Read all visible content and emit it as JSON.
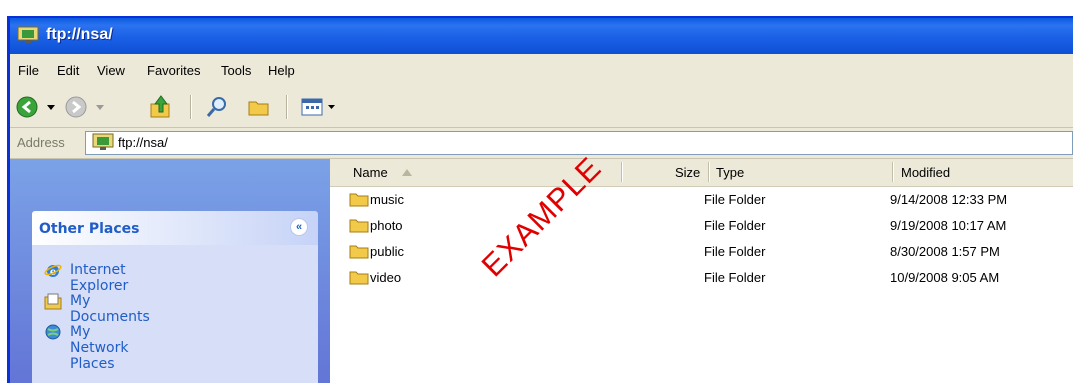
{
  "window": {
    "title": "ftp://nsa/",
    "title_icon": "network-folder-icon"
  },
  "menu": [
    "File",
    "Edit",
    "View",
    "Favorites",
    "Tools",
    "Help"
  ],
  "toolbar": {
    "buttons": [
      "back-icon",
      "forward-icon",
      "up-folder-icon",
      "search-icon",
      "folders-icon",
      "views-icon"
    ]
  },
  "address": {
    "label": "Address",
    "value": "ftp://nsa/"
  },
  "task_pane": {
    "section_title": "Other Places",
    "collapse_glyph": "«",
    "links": [
      {
        "label": "Internet Explorer",
        "icon": "internet-explorer-icon"
      },
      {
        "label": "My Documents",
        "icon": "my-documents-icon"
      },
      {
        "label": "My Network Places",
        "icon": "network-places-icon"
      }
    ]
  },
  "file_list": {
    "columns": [
      "Name",
      "Size",
      "Type",
      "Modified"
    ],
    "rows": [
      {
        "name": "music",
        "type": "File Folder",
        "modified": "9/14/2008 12:33 PM"
      },
      {
        "name": "photo",
        "type": "File Folder",
        "modified": "9/19/2008 10:17 AM"
      },
      {
        "name": "public",
        "type": "File Folder",
        "modified": "8/30/2008 1:57 PM"
      },
      {
        "name": "video",
        "type": "File Folder",
        "modified": "10/9/2008 9:05 AM"
      }
    ]
  },
  "watermark": "EXAMPLE",
  "colors": {
    "titlebar": "#0a5be0",
    "chrome": "#ece9d8",
    "taskpane": "#6b8fe3",
    "link": "#215dc6",
    "watermark": "#e00000"
  }
}
